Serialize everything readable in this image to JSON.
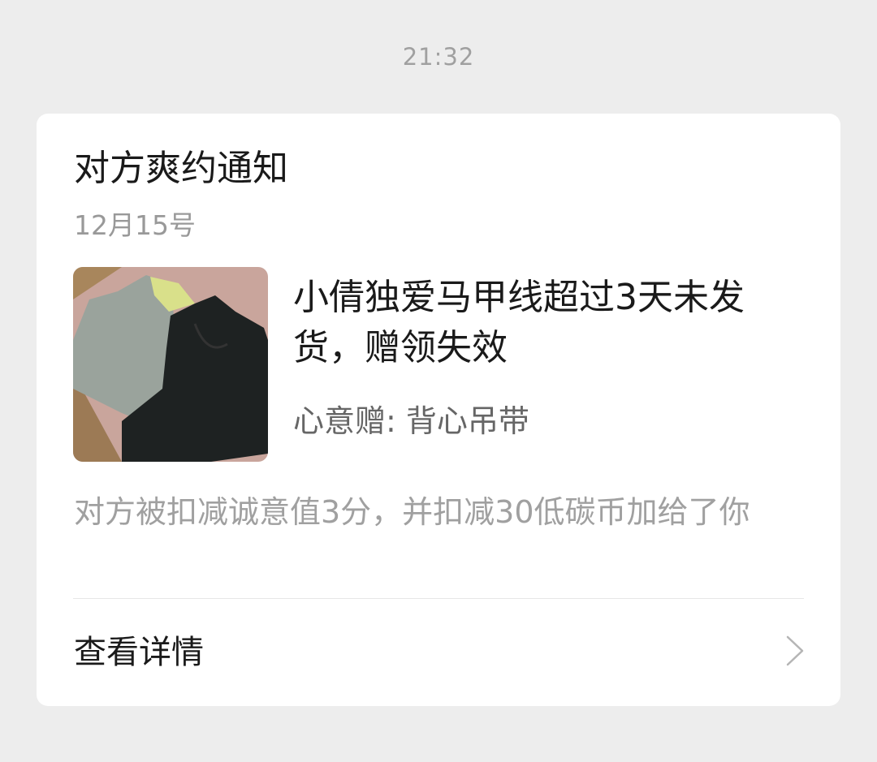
{
  "timestamp": "21:32",
  "card": {
    "title": "对方爽约通知",
    "date": "12月15号",
    "product": {
      "name": "小倩独爱马甲线超过3天未发货，赠领失效",
      "gift_line": "心意赠: 背心吊带",
      "image_icon": "product-photo-vest-tops"
    },
    "penalty_text": "对方被扣减诚意值3分，并扣减30低碳币加给了你",
    "details_label": "查看详情",
    "details_icon": "chevron-right-icon"
  },
  "colors": {
    "background": "#ededed",
    "card": "#ffffff",
    "primary_text": "#1a1a1a",
    "secondary_text": "#999999",
    "divider": "#e6e6e6"
  }
}
